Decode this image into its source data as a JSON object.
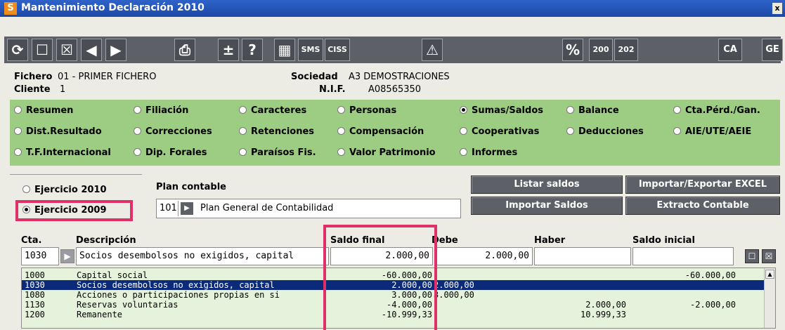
{
  "window": {
    "title": "Mantenimiento Declaración 2010",
    "app_icon": "S",
    "close": "x"
  },
  "toolbar": {
    "buttons": [
      {
        "name": "refresh-icon",
        "glyph": "⟳"
      },
      {
        "name": "new-icon",
        "glyph": "☐"
      },
      {
        "name": "delete-icon",
        "glyph": "☒"
      },
      {
        "name": "prev-icon",
        "glyph": "◀"
      },
      {
        "name": "next-icon",
        "glyph": "▶"
      },
      {
        "name": "print-icon",
        "glyph": "⎙"
      },
      {
        "name": "plus-minus-icon",
        "glyph": "±"
      },
      {
        "name": "help-icon",
        "glyph": "?"
      },
      {
        "name": "calculator-icon",
        "glyph": "▦"
      },
      {
        "name": "sms-button",
        "glyph": "SMS"
      },
      {
        "name": "ciss-button",
        "glyph": "CISS"
      },
      {
        "name": "warning-icon",
        "glyph": "⚠"
      },
      {
        "name": "percent-icon",
        "glyph": "%"
      },
      {
        "name": "model-200-button",
        "glyph": "200"
      },
      {
        "name": "model-202-button",
        "glyph": "202"
      },
      {
        "name": "ca-button",
        "glyph": "CA"
      },
      {
        "name": "ge-button",
        "glyph": "GE"
      }
    ]
  },
  "info": {
    "fichero_label": "Fichero",
    "fichero_value": "01 - PRIMER FICHERO",
    "cliente_label": "Cliente",
    "cliente_value": "1",
    "sociedad_label": "Sociedad",
    "sociedad_value": "A3 DEMOSTRACIONES",
    "nif_label": "N.I.F.",
    "nif_value": "A08565350"
  },
  "sections": [
    [
      "Resumen",
      "Filiación",
      "Caracteres",
      "Personas",
      "Sumas/Saldos",
      "Balance",
      "Cta.Pérd./Gan."
    ],
    [
      "Dist.Resultado",
      "Correcciones",
      "Retenciones",
      "Compensación",
      "Cooperativas",
      "Deducciones",
      "AIE/UTE/AEIE"
    ],
    [
      "T.F.Internacional",
      "Dip. Forales",
      "Paraísos Fis.",
      "Valor Patrimonio",
      "Informes"
    ]
  ],
  "selected_section": "Sumas/Saldos",
  "ejercicio": {
    "options": [
      "Ejercicio 2010",
      "Ejercicio 2009"
    ],
    "selected": "Ejercicio 2009"
  },
  "plan": {
    "label": "Plan contable",
    "code": "101",
    "name": "Plan General de Contabilidad"
  },
  "actions": {
    "listar": "Listar saldos",
    "importar_excel": "Importar/Exportar EXCEL",
    "importar_saldos": "Importar Saldos",
    "extracto": "Extracto Contable"
  },
  "columns": {
    "cta": "Cta.",
    "descripcion": "Descripción",
    "saldo_final": "Saldo final",
    "debe": "Debe",
    "haber": "Haber",
    "saldo_inicial": "Saldo inicial"
  },
  "edit_row": {
    "cta": "1030",
    "descripcion": "Socios desembolsos no exigidos, capital",
    "saldo_final": "2.000,00",
    "debe": "2.000,00",
    "haber": "",
    "saldo_inicial": ""
  },
  "rows": [
    {
      "cta": "1000",
      "descripcion": "Capital social",
      "saldo_final": "-60.000,00",
      "debe": "",
      "haber": "",
      "saldo_inicial": "-60.000,00",
      "selected": false
    },
    {
      "cta": "1030",
      "descripcion": "Socios desembolsos no exigidos, capital",
      "saldo_final": "2.000,00",
      "debe": "2.000,00",
      "haber": "",
      "saldo_inicial": "",
      "selected": true
    },
    {
      "cta": "1080",
      "descripcion": "Acciones o participaciones propias en si",
      "saldo_final": "3.000,00",
      "debe": "3.000,00",
      "haber": "",
      "saldo_inicial": "",
      "selected": false
    },
    {
      "cta": "1130",
      "descripcion": "Reservas voluntarias",
      "saldo_final": "-4.000,00",
      "debe": "",
      "haber": "2.000,00",
      "saldo_inicial": "-2.000,00",
      "selected": false
    },
    {
      "cta": "1200",
      "descripcion": "Remanente",
      "saldo_final": "-10.999,33",
      "debe": "",
      "haber": "10.999,33",
      "saldo_inicial": "",
      "selected": false
    }
  ],
  "colors": {
    "green_panel": "#9ccd82",
    "highlight": "#e0306a",
    "selection": "#0c2a7a",
    "title_bar": "#2f63c9"
  }
}
